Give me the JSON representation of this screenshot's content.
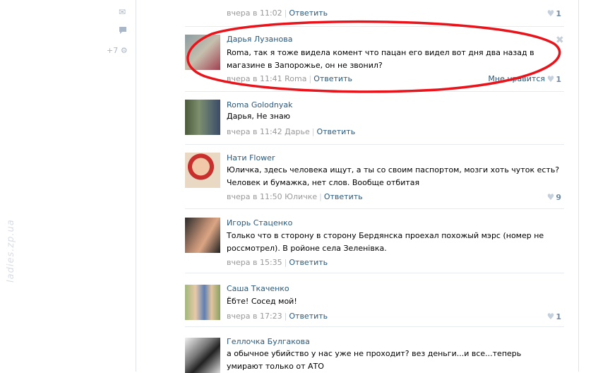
{
  "sidebar": {
    "counter": "+7",
    "watermark": "ladies.zp.ua"
  },
  "top_meta": {
    "time": "вчера в 11:02",
    "reply": "Ответить",
    "likes": "1"
  },
  "comments": [
    {
      "author": "Дарья Лузанова",
      "text": "Roma, так я тоже видела комент что пацан его видел вот дня два назад в магазине в Запорожье, он не звонил?",
      "time": "вчера в 11:41 Roma",
      "reply": "Ответить",
      "notlike": "Мне нравится",
      "likes": "1"
    },
    {
      "author": "Roma Golodnyak",
      "text": "Дарья, Не знаю",
      "time": "вчера в 11:42 Дарье",
      "reply": "Ответить",
      "likes": ""
    },
    {
      "author": "Нати Flower",
      "text": "Юличка, здесь человека ищут, а ты со своим паспортом, мозги хоть чуток есть? Человек и бумажка, нет слов. Вообще отбитая",
      "time": "вчера в 11:50 Юличке",
      "reply": "Ответить",
      "likes": "9"
    },
    {
      "author": "Игорь Стаценко",
      "text": "Только что в сторону в сторону Бердянска проехал похожый мэрс (номер не россмотрел). В ройоне села Зеленівка.",
      "time": "вчера в 15:35",
      "reply": "Ответить",
      "likes": ""
    },
    {
      "author": "Саша Ткаченко",
      "text": "Ёбте! Сосед мой!",
      "time": "вчера в 17:23",
      "reply": "Ответить",
      "likes": "1"
    },
    {
      "author": "Геллочка Булгакова",
      "text": "а обычное убийство у нас уже не проходит? вез деньги...и все...теперь умирают только от АТО",
      "time": "",
      "reply": "",
      "likes": ""
    }
  ],
  "colors": {
    "link": "#2b587a",
    "meta": "#999999",
    "ellipse": "#e8141b",
    "likes": "#6f8aa6"
  },
  "icons": [
    "envelope-icon",
    "speech-bubble-icon",
    "gear-icon",
    "heart-icon",
    "close-icon"
  ]
}
